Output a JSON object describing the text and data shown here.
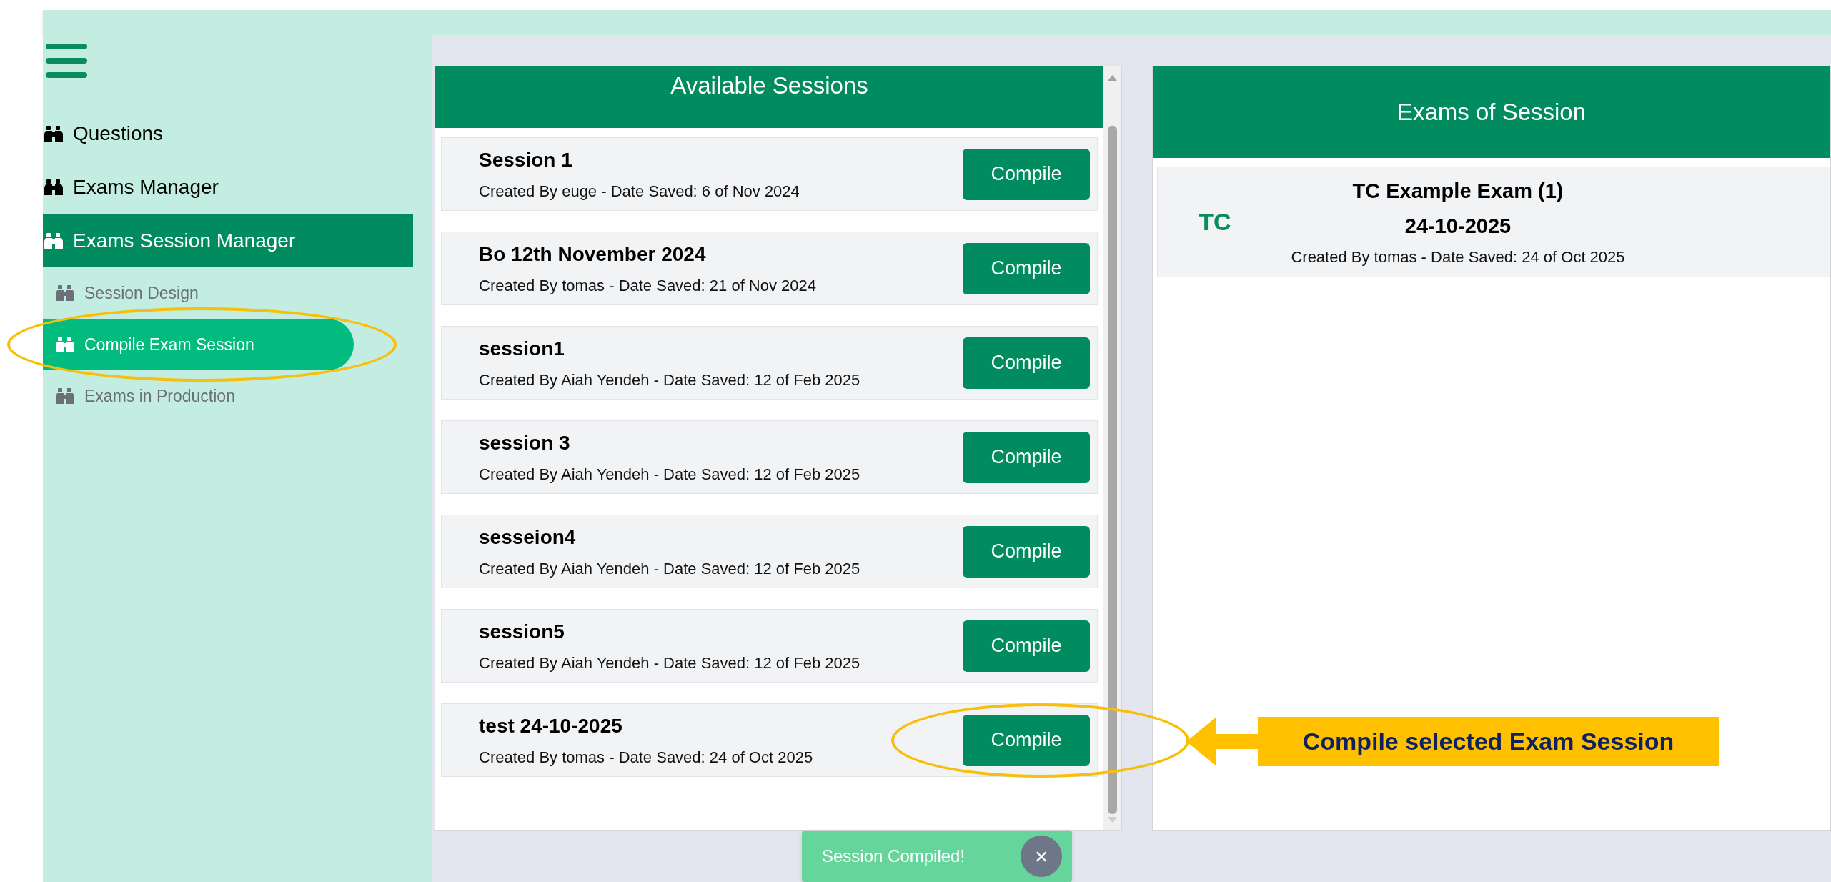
{
  "sidebar": {
    "items": [
      {
        "label": "Questions",
        "selected": false
      },
      {
        "label": "Exams Manager",
        "selected": false
      },
      {
        "label": "Exams Session Manager",
        "selected": true,
        "children": [
          {
            "label": "Session Design",
            "selected": false,
            "circled": false
          },
          {
            "label": "Compile Exam Session",
            "selected": true,
            "circled": true
          },
          {
            "label": "Exams in Production",
            "selected": false,
            "circled": false
          }
        ]
      }
    ]
  },
  "sessions_panel": {
    "title": "Available Sessions",
    "items": [
      {
        "name": "Session 1",
        "meta": "Created By euge - Date Saved: 6 of Nov 2024",
        "button": "Compile",
        "circled": false
      },
      {
        "name": "Bo 12th November 2024",
        "meta": "Created By tomas - Date Saved: 21 of Nov 2024",
        "button": "Compile",
        "circled": false
      },
      {
        "name": "session1",
        "meta": "Created By Aiah Yendeh - Date Saved: 12 of Feb 2025",
        "button": "Compile",
        "circled": false
      },
      {
        "name": "session 3",
        "meta": "Created By Aiah Yendeh - Date Saved: 12 of Feb 2025",
        "button": "Compile",
        "circled": false
      },
      {
        "name": "sesseion4",
        "meta": "Created By Aiah Yendeh - Date Saved: 12 of Feb 2025",
        "button": "Compile",
        "circled": false
      },
      {
        "name": "session5",
        "meta": "Created By Aiah Yendeh - Date Saved: 12 of Feb 2025",
        "button": "Compile",
        "circled": false
      },
      {
        "name": "test 24-10-2025",
        "meta": "Created By tomas - Date Saved: 24 of Oct 2025",
        "button": "Compile",
        "circled": true
      }
    ]
  },
  "exams_panel": {
    "title": "Exams of Session",
    "items": [
      {
        "badge": "TC",
        "title": "TC Example Exam (1)",
        "subtitle": "24-10-2025",
        "meta": "Created By tomas - Date Saved: 24 of Oct 2025"
      }
    ]
  },
  "callout": {
    "text": "Compile selected Exam Session"
  },
  "toast": {
    "text": "Session Compiled!",
    "close": "×"
  }
}
